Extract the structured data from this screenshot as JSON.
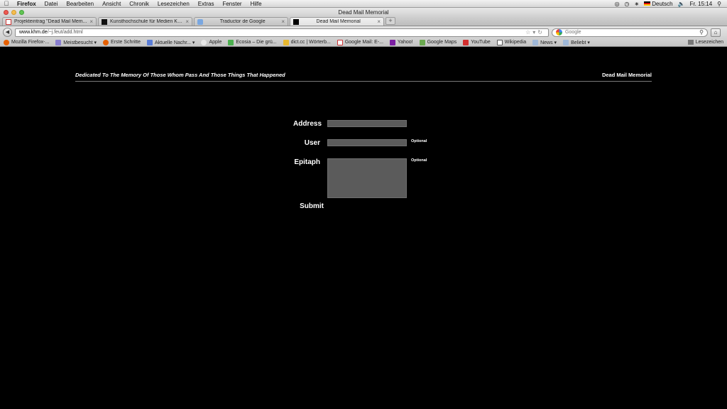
{
  "menubar": {
    "app": "Firefox",
    "items": [
      "Datei",
      "Bearbeiten",
      "Ansicht",
      "Chronik",
      "Lesezeichen",
      "Extras",
      "Fenster",
      "Hilfe"
    ],
    "language": "Deutsch",
    "clock": "Fr. 15:14"
  },
  "window": {
    "title": "Dead Mail Memorial"
  },
  "tabs": [
    {
      "label": "Projekteintrag \"Dead Mail Mem...",
      "active": false
    },
    {
      "label": "Kunsthochschule für Medien Kö...",
      "active": false
    },
    {
      "label": "Traductor de Google",
      "active": false
    },
    {
      "label": "Dead Mail Memorial",
      "active": true
    }
  ],
  "navbar": {
    "url_host": "www.khm.de",
    "url_path": "/~j.feut/add.html",
    "search_placeholder": "Google"
  },
  "bookmarks": {
    "items": [
      "Mozilla Firefox-...",
      "Meistbesucht ▾",
      "Erste Schritte",
      "Aktuelle Nachr... ▾",
      "Apple",
      "Ecosia – Die grü...",
      "dict.cc | Wörterb...",
      "Google Mail: E-...",
      "Yahoo!",
      "Google Maps",
      "YouTube",
      "Wikipedia",
      "News ▾",
      "Beliebt ▾"
    ],
    "right": "Lesezeichen"
  },
  "page": {
    "tagline": "Dedicated To The Memory Of Those Whom Pass And Those Things That Happened",
    "site_name": "Dead Mail Memorial",
    "form": {
      "address_label": "Address",
      "user_label": "User",
      "epitaph_label": "Epitaph",
      "optional": "Optional",
      "submit_label": "Submit"
    }
  },
  "colors": {
    "page_bg": "#000000",
    "field_bg": "#5b5b5b",
    "text": "#ffffff"
  }
}
